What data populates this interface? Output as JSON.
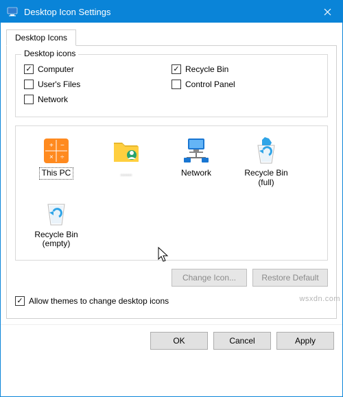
{
  "window": {
    "title": "Desktop Icon Settings",
    "close_tooltip": "Close"
  },
  "tab": {
    "label": "Desktop Icons"
  },
  "group": {
    "legend": "Desktop icons"
  },
  "checks": {
    "computer": {
      "label": "Computer",
      "checked": true
    },
    "usersfiles": {
      "label": "User's Files",
      "checked": false
    },
    "network": {
      "label": "Network",
      "checked": false
    },
    "recyclebin": {
      "label": "Recycle Bin",
      "checked": true
    },
    "controlpanel": {
      "label": "Control Panel",
      "checked": false
    }
  },
  "icons": {
    "thispc": {
      "label": "This PC"
    },
    "userfolder": {
      "label": "....."
    },
    "network": {
      "label": "Network"
    },
    "recyclefull": {
      "label": "Recycle Bin\n(full)"
    },
    "recycleempty": {
      "label": "Recycle Bin\n(empty)"
    }
  },
  "buttons": {
    "changeicon": "Change Icon...",
    "restoredefault": "Restore Default",
    "ok": "OK",
    "cancel": "Cancel",
    "apply": "Apply"
  },
  "allow_themes": {
    "label": "Allow themes to change desktop icons",
    "checked": true
  },
  "watermark": "wsxdn.com"
}
